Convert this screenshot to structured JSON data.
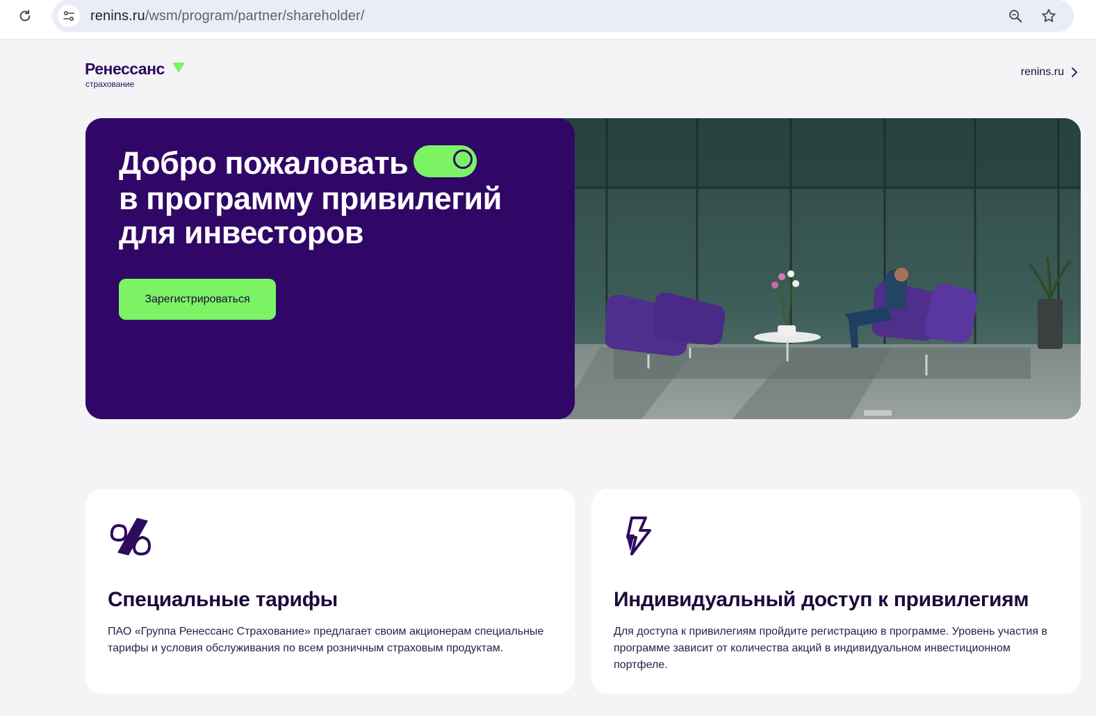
{
  "browser": {
    "url_domain": "renins.ru",
    "url_path": "/wsm/program/partner/shareholder/"
  },
  "header": {
    "logo_word": "Ренессанс",
    "logo_sub": "страхование",
    "site_link": "renins.ru"
  },
  "hero": {
    "title_line1": "Добро пожаловать",
    "title_line2": "в программу привилегий",
    "title_line3": "для инвесторов",
    "cta_label": "Зарегистрироваться"
  },
  "cards": [
    {
      "icon": "percent-icon",
      "title": "Специальные тарифы",
      "text": "ПАО «Группа Ренессанс Страхование» предлагает своим акционерам специальные тарифы и условия обслуживания по всем розничным страховым продуктам."
    },
    {
      "icon": "lightning-icon",
      "title": "Индивидуальный доступ к привилегиям",
      "text": "Для доступа к привилегиям пройдите регистрацию в программе. Уровень участия в программе зависит от количества акций в индивидуальном инвестиционном портфеле."
    }
  ],
  "colors": {
    "brand_purple": "#300766",
    "accent_green": "#7cf265",
    "page_bg": "#f4f4f6"
  }
}
